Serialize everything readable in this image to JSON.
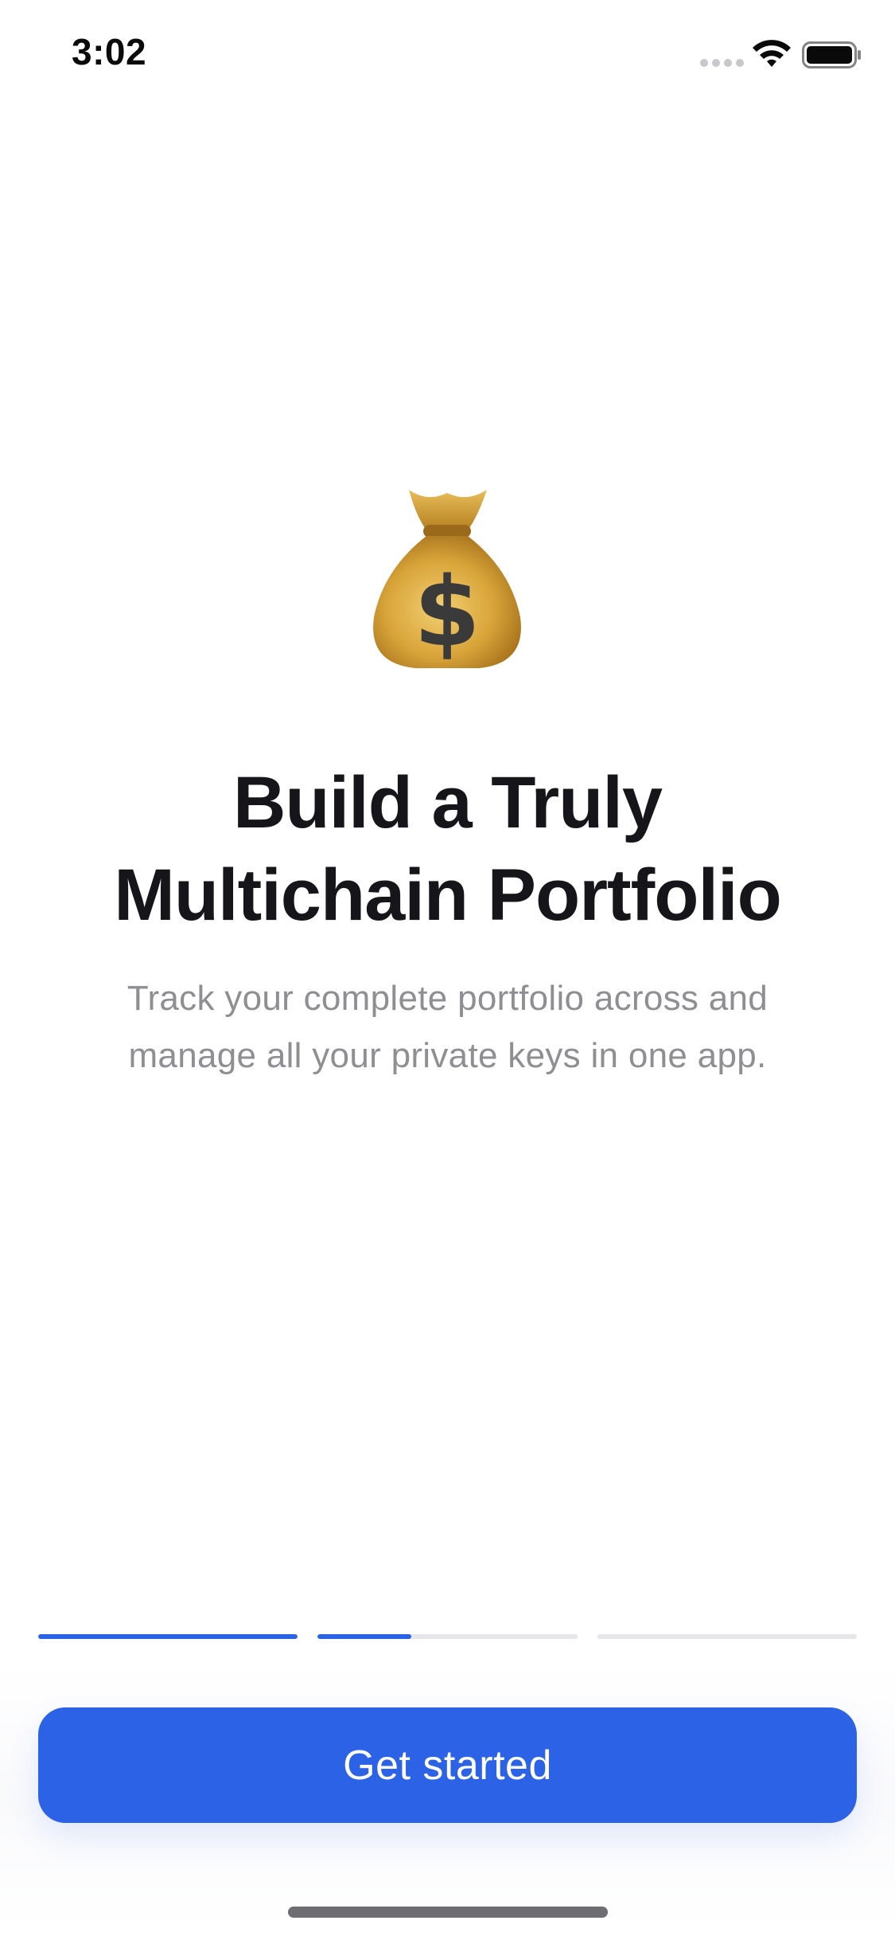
{
  "status_bar": {
    "time": "3:02",
    "wifi_icon": "wifi-icon",
    "battery_icon": "battery-icon",
    "signal_icon": "signal-dots-icon"
  },
  "hero": {
    "emoji_icon": "money-bag-icon",
    "title_line1": "Build a Truly",
    "title_line2": "Multichain Portfolio",
    "subtitle_line1": "Track your complete portfolio across and",
    "subtitle_line2": "manage all your private keys in one app."
  },
  "progress": {
    "segments": [
      {
        "fill": 1.0
      },
      {
        "fill": 0.36
      },
      {
        "fill": 0.0
      }
    ]
  },
  "cta": {
    "label": "Get started"
  },
  "colors": {
    "accent": "#2c62e6",
    "track": "#e6e6ea",
    "title": "#16161a",
    "subtitle": "#8e8e93"
  }
}
